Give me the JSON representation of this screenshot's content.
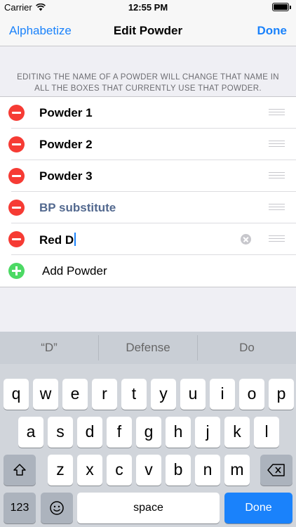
{
  "status_bar": {
    "carrier": "Carrier",
    "time": "12:55 PM"
  },
  "nav": {
    "left": "Alphabetize",
    "title": "Edit Powder",
    "right": "Done"
  },
  "section_header": "EDITING THE NAME OF A POWDER WILL CHANGE THAT NAME IN ALL THE BOXES THAT CURRENTLY USE THAT POWDER.",
  "rows": [
    {
      "label": "Powder 1"
    },
    {
      "label": "Powder 2"
    },
    {
      "label": "Powder 3"
    },
    {
      "label": "BP substitute"
    },
    {
      "label": "Red D"
    }
  ],
  "add_label": "Add Powder",
  "keyboard": {
    "suggestions": [
      "“D”",
      "Defense",
      "Do"
    ],
    "row1": [
      "q",
      "w",
      "e",
      "r",
      "t",
      "y",
      "u",
      "i",
      "o",
      "p"
    ],
    "row2": [
      "a",
      "s",
      "d",
      "f",
      "g",
      "h",
      "j",
      "k",
      "l"
    ],
    "row3": [
      "z",
      "x",
      "c",
      "v",
      "b",
      "n",
      "m"
    ],
    "numbers": "123",
    "space": "space",
    "done": "Done"
  }
}
